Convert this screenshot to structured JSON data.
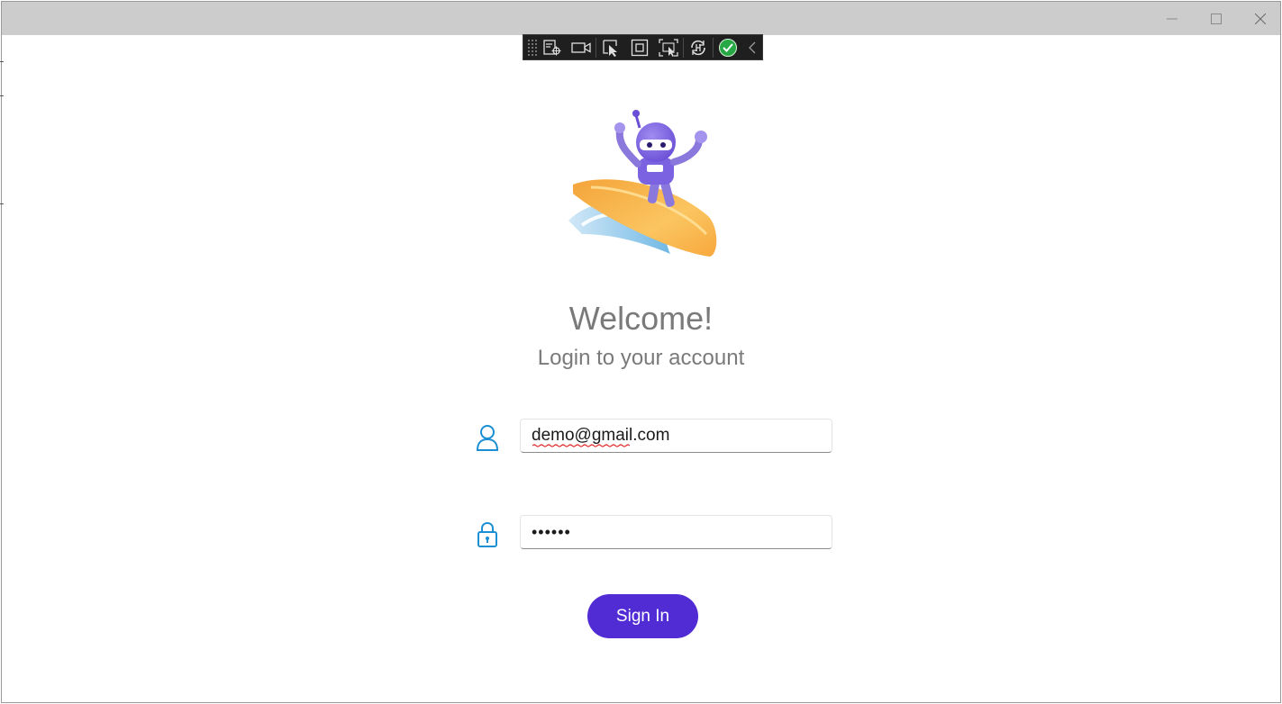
{
  "window": {
    "controls": {
      "minimize_icon": "minimize-icon",
      "maximize_icon": "maximize-icon",
      "close_icon": "close-icon"
    }
  },
  "debug_toolbar": {
    "tools": [
      "live-visual-tree-icon",
      "record-icon",
      "select-element-icon",
      "display-layout-adorners-icon",
      "track-focus-icon",
      "hot-reload-icon",
      "status-ok-icon",
      "collapse-chevron-icon"
    ],
    "status_color": "#27a844"
  },
  "login": {
    "logo": "dotnet-bot-surfer",
    "title": "Welcome!",
    "subtitle": "Login to your account",
    "email": {
      "icon": "user-icon",
      "value": "demo@gmail.com"
    },
    "password": {
      "icon": "lock-icon",
      "value": "••••••"
    },
    "sign_in_label": "Sign In",
    "accent_color": "#512bd4",
    "icon_color": "#1a8fd4"
  }
}
